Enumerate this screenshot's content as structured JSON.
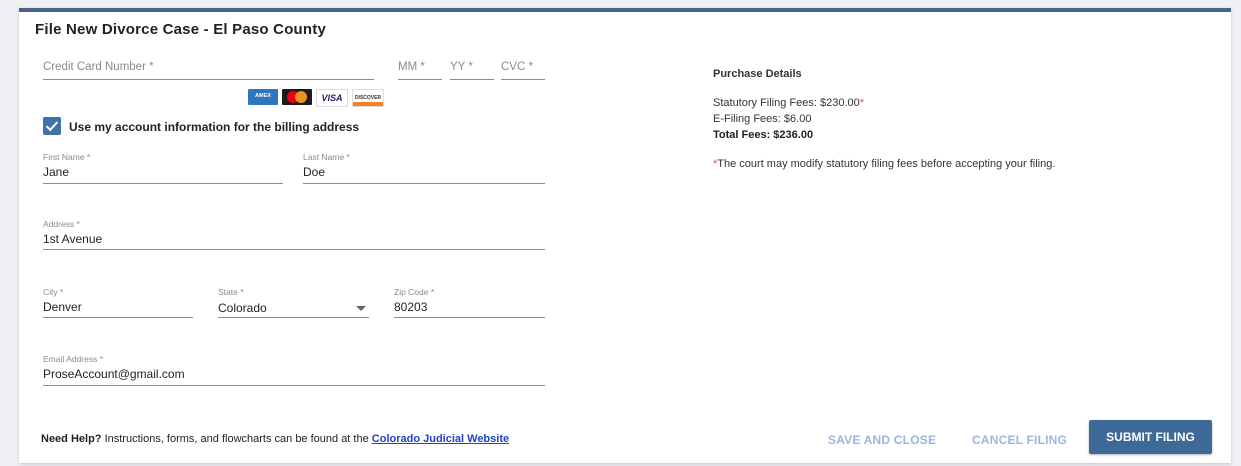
{
  "page_title": "File New Divorce Case - El Paso County",
  "payment": {
    "card_number_placeholder": "Credit Card Number *",
    "mm_placeholder": "MM *",
    "yy_placeholder": "YY *",
    "cvc_placeholder": "CVC *",
    "card_logos": [
      "AMERICAN EXPRESS",
      "MasterCard",
      "VISA",
      "DISCOVER"
    ]
  },
  "billing_checkbox": {
    "label": "Use my account information for the billing address",
    "checked": true
  },
  "form": {
    "first_name": {
      "label": "First Name *",
      "value": "Jane"
    },
    "last_name": {
      "label": "Last Name *",
      "value": "Doe"
    },
    "address": {
      "label": "Address *",
      "value": "1st Avenue"
    },
    "city": {
      "label": "City *",
      "value": "Denver"
    },
    "state": {
      "label": "State *",
      "value": "Colorado"
    },
    "zip": {
      "label": "Zip Code *",
      "value": "80203"
    },
    "email": {
      "label": "Email Address *",
      "value": "ProseAccount@gmail.com"
    }
  },
  "purchase": {
    "title": "Purchase Details",
    "statutory": "Statutory Filing Fees: $230.00",
    "statutory_mark": "*",
    "efiling": "E-Filing Fees: $6.00",
    "total": "Total Fees: $236.00",
    "note_mark": "*",
    "note": "The court may modify statutory filing fees before accepting your filing."
  },
  "help": {
    "bold": "Need Help?",
    "text": " Instructions, forms, and flowcharts can be found at the ",
    "link": "Colorado Judicial Website"
  },
  "buttons": {
    "save": "SAVE AND CLOSE",
    "cancel": "CANCEL FILING",
    "submit": "SUBMIT FILING"
  },
  "colors": {
    "accent": "#3d6a99",
    "header_border": "#4a6285",
    "checkbox": "#3f72a8",
    "text_button": "#9bb5dc",
    "required_mark": "#d9534f",
    "link": "#1f44c8"
  }
}
